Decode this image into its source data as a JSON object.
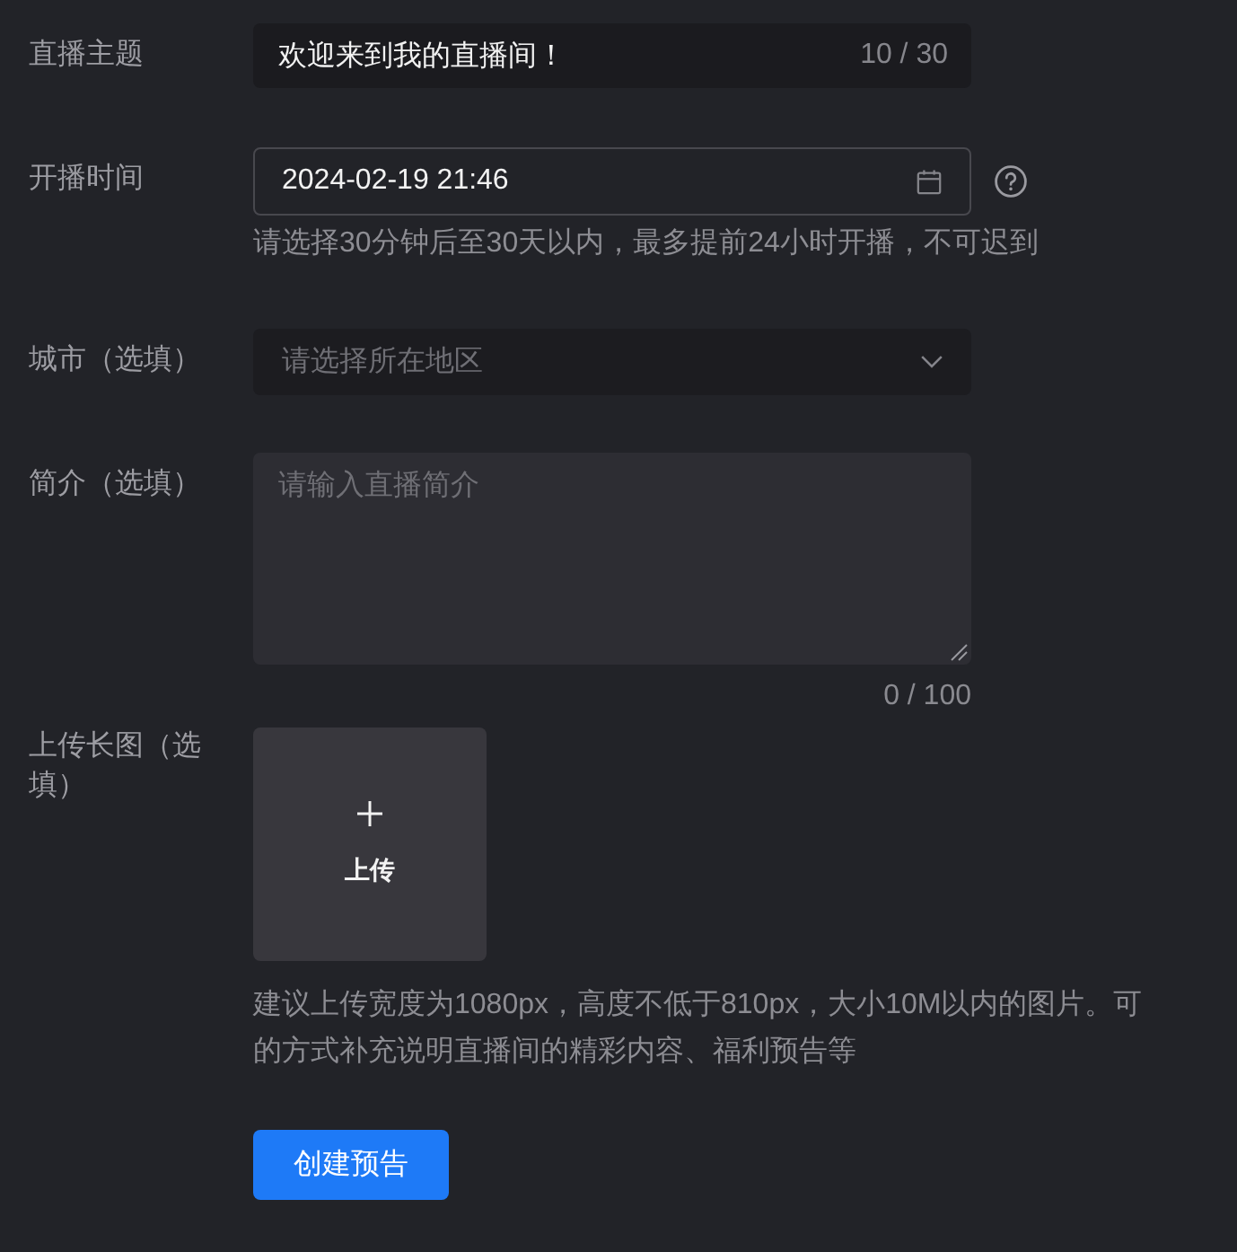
{
  "form": {
    "items": [
      {
        "kind": "text",
        "label": "直播主题",
        "value": "欢迎来到我的直播间！",
        "counter": "10 / 30"
      },
      {
        "kind": "datetime",
        "label": "开播时间",
        "value": "2024-02-19 21:46",
        "hint": "请选择30分钟后至30天以内，最多提前24小时开播，不可迟到"
      },
      {
        "kind": "select",
        "label": "城市（选填）",
        "placeholder": "请选择所在地区"
      },
      {
        "kind": "textarea",
        "label": "简介（选填）",
        "placeholder": "请输入直播简介",
        "counter": "0 / 100"
      },
      {
        "kind": "upload",
        "label": "上传长图（选填）",
        "button": "上传",
        "hint_lines": [
          "建议上传宽度为1080px，高度不低于810px，大小10M以内的图片。可",
          "的方式补充说明直播间的精彩内容、福利预告等"
        ]
      }
    ],
    "submit": "创建预告"
  }
}
